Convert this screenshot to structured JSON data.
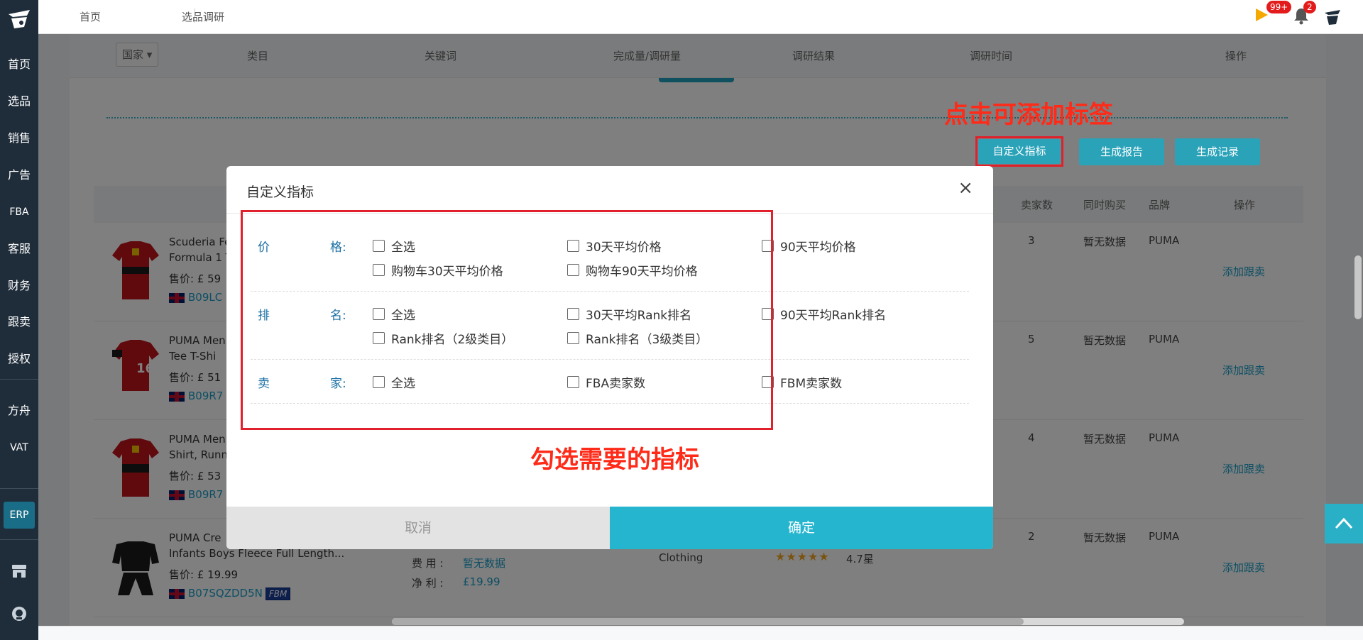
{
  "sidebar": {
    "items": [
      {
        "label": "首页"
      },
      {
        "label": "选品"
      },
      {
        "label": "销售"
      },
      {
        "label": "广告"
      },
      {
        "label": "FBA"
      },
      {
        "label": "客服"
      },
      {
        "label": "财务"
      },
      {
        "label": "跟卖"
      },
      {
        "label": "授权"
      },
      {
        "label": "方舟"
      },
      {
        "label": "VAT"
      }
    ],
    "erp": "ERP"
  },
  "topbar": {
    "crumbs": [
      "首页",
      "选品调研"
    ],
    "flag_badge": "99+",
    "bell_badge": "2"
  },
  "filter_header": {
    "country": "国家",
    "columns": [
      "类目",
      "关键词",
      "完成量/调研量",
      "调研结果",
      "调研时间",
      "操作"
    ]
  },
  "annotations": {
    "add_tag_tip": "点击可添加标签",
    "select_tip": "勾选需要的指标"
  },
  "toolbar": {
    "custom_metric": "自定义指标",
    "generate_report": "生成报告",
    "generate_record": "生成记录"
  },
  "table": {
    "headers": [
      "卖家数",
      "同时购买",
      "品牌",
      "操作"
    ],
    "rows": [
      {
        "title1": "Scuderia Fe",
        "title2": "Formula 1 T",
        "price": "售价: £ 59",
        "asin": "B09LC",
        "sellers": "3",
        "also_bought": "暂无数据",
        "brand": "PUMA",
        "action": "添加跟卖"
      },
      {
        "title1": "PUMA Men",
        "title2": "Tee T-Shi",
        "price": "售价: £ 51",
        "asin": "B09R7",
        "sellers": "5",
        "also_bought": "暂无数据",
        "brand": "PUMA",
        "action": "添加跟卖"
      },
      {
        "title1": "PUMA Men",
        "title2": "Shirt, Runn",
        "price": "售价: £ 53",
        "asin": "B09R7",
        "sellers": "4",
        "also_bought": "暂无数据",
        "brand": "PUMA",
        "action": "添加跟卖"
      },
      {
        "title1": "PUMA Cre",
        "title2": "Infants Boys Fleece Full Length...",
        "price": "售价: £ 19.99",
        "asin": "B07SQZDD5N",
        "badge": "FBM",
        "fee_label": "费  用 :",
        "fee_value": "暂无数据",
        "profit_label": "净  利 :",
        "profit_value": "£19.99",
        "category": "Clothing",
        "rating": "4.7星",
        "sellers": "2",
        "also_bought": "暂无数据",
        "brand": "PUMA",
        "action": "添加跟卖"
      }
    ]
  },
  "modal": {
    "title": "自定义指标",
    "close": "×",
    "groups": [
      {
        "label_a": "价",
        "label_b": "格:",
        "options": [
          "全选",
          "30天平均价格",
          "90天平均价格",
          "购物车30天平均价格",
          "购物车90天平均价格"
        ]
      },
      {
        "label_a": "排",
        "label_b": "名:",
        "options": [
          "全选",
          "30天平均Rank排名",
          "90天平均Rank排名",
          "Rank排名（2级类目）",
          "Rank排名（3级类目）"
        ]
      },
      {
        "label_a": "卖",
        "label_b": "家:",
        "options": [
          "全选",
          "FBA卖家数",
          "FBM卖家数"
        ]
      }
    ],
    "cancel": "取消",
    "ok": "确定"
  }
}
